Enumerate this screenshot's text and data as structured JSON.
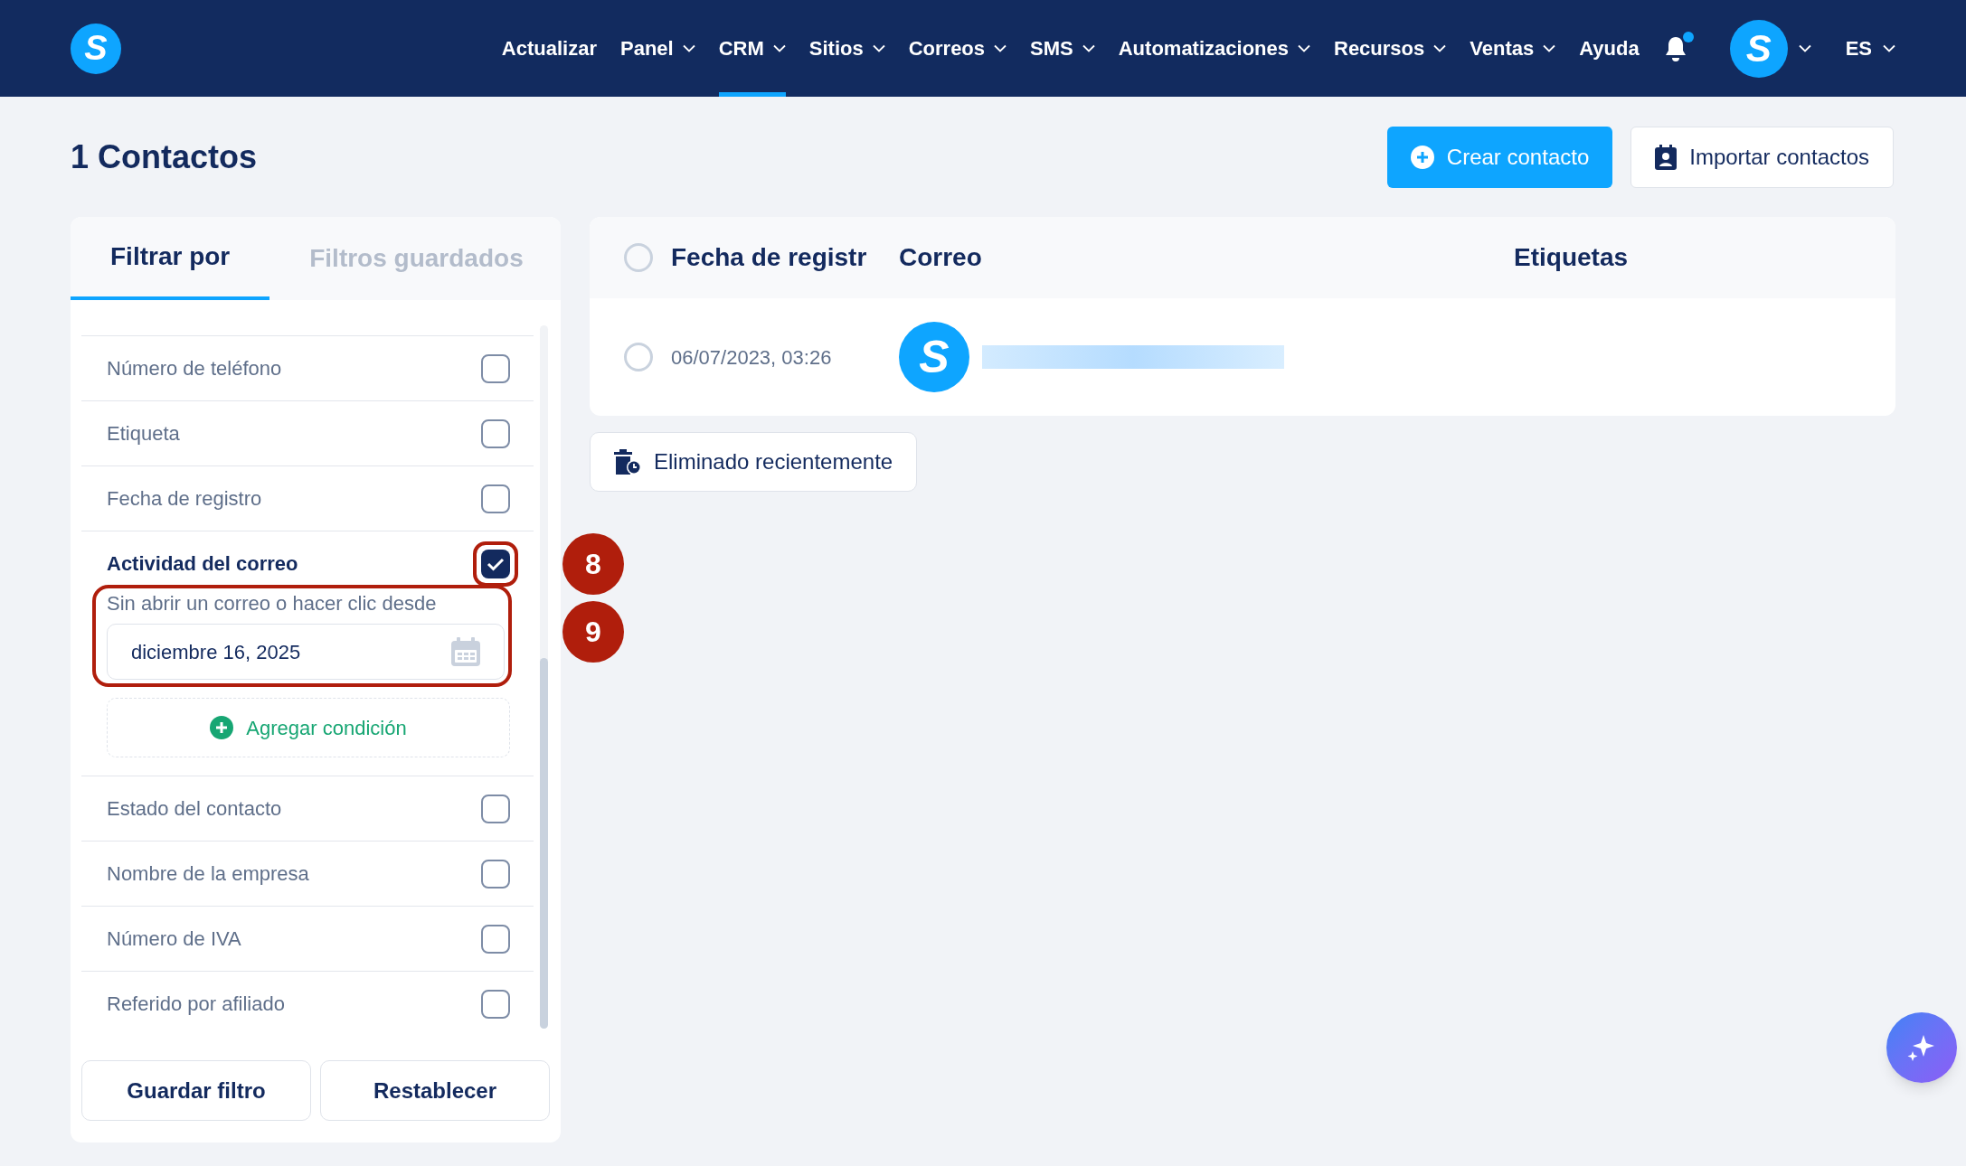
{
  "nav": {
    "items": [
      {
        "label": "Actualizar",
        "dropdown": false,
        "selected": false
      },
      {
        "label": "Panel",
        "dropdown": true,
        "selected": false
      },
      {
        "label": "CRM",
        "dropdown": true,
        "selected": true
      },
      {
        "label": "Sitios",
        "dropdown": true,
        "selected": false
      },
      {
        "label": "Correos",
        "dropdown": true,
        "selected": false
      },
      {
        "label": "SMS",
        "dropdown": true,
        "selected": false
      },
      {
        "label": "Automatizaciones",
        "dropdown": true,
        "selected": false
      },
      {
        "label": "Recursos",
        "dropdown": true,
        "selected": false
      },
      {
        "label": "Ventas",
        "dropdown": true,
        "selected": false
      },
      {
        "label": "Ayuda",
        "dropdown": false,
        "selected": false
      }
    ],
    "notification_unread": true,
    "avatar_letter": "S",
    "language": "ES",
    "logo_letter": "S"
  },
  "page_title": "1 Contactos",
  "actions": [
    "Crear contacto",
    "Importar contactos"
  ],
  "filter_panel": {
    "tabs": [
      {
        "label": "Filtrar por",
        "selected": true
      },
      {
        "label": "Filtros guardados",
        "selected": false
      }
    ],
    "items": [
      {
        "label": "Número de teléfono",
        "checked": false
      },
      {
        "label": "Etiqueta",
        "checked": false
      },
      {
        "label": "Fecha de registro",
        "checked": false
      },
      {
        "label": "Actividad del correo",
        "checked": true,
        "callout": "8",
        "condition": {
          "label": "Sin abrir un correo o hacer clic desde",
          "value": "diciembre 16, 2025",
          "callout": "9"
        },
        "add_condition": "Agregar condición"
      },
      {
        "label": "Estado del contacto",
        "checked": false
      },
      {
        "label": "Nombre de la empresa",
        "checked": false
      },
      {
        "label": "Número de IVA",
        "checked": false
      },
      {
        "label": "Referido por afiliado",
        "checked": false
      }
    ],
    "buttons": [
      "Guardar filtro",
      "Restablecer"
    ]
  },
  "table": {
    "all_selected": false,
    "columns": [
      "Fecha de registr",
      "Correo",
      "Etiquetas"
    ],
    "rows": [
      {
        "selected": false,
        "date": "06/07/2023, 03:26",
        "avatar_letter": "S"
      }
    ]
  },
  "recently_deleted": "Eliminado recientemente"
}
